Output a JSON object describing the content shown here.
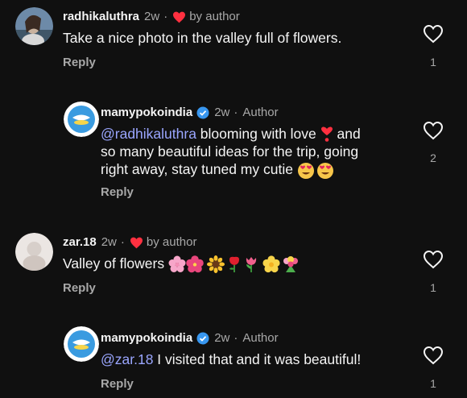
{
  "comments": [
    {
      "username": "radhikaluthra",
      "time": "2w",
      "by_author": "by author",
      "text": "Take a nice photo in the valley full of flowers.",
      "reply_label": "Reply",
      "likes": "1"
    },
    {
      "username": "mamypokoindia",
      "time": "2w",
      "author_tag": "Author",
      "mention": "@radhikaluthra",
      "text_1": " blooming with love ",
      "text_2": " and",
      "text_3": "so many beautiful ideas for the trip, going",
      "text_4": "right away, stay tuned my cutie ",
      "reply_label": "Reply",
      "likes": "2"
    },
    {
      "username": "zar.18",
      "time": "2w",
      "by_author": "by author",
      "text": "Valley of flowers ",
      "reply_label": "Reply",
      "likes": "1"
    },
    {
      "username": "mamypokoindia",
      "time": "2w",
      "author_tag": "Author",
      "mention": "@zar.18",
      "text": " I visited that and it was beautiful!",
      "reply_label": "Reply",
      "likes": "1"
    }
  ],
  "dot_separator": "·",
  "colors": {
    "background": "#101010",
    "mention": "#9aa6ff",
    "heart": "#ff3040",
    "verified": "#3897f0",
    "secondary_text": "#a8a8a8"
  }
}
